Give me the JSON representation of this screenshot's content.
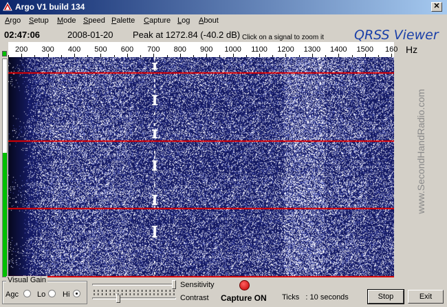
{
  "window": {
    "title": "Argo V1 build 134",
    "close_label": "✕"
  },
  "menu": [
    {
      "label": "Argo",
      "accel": "A",
      "rest": "rgo"
    },
    {
      "label": "Setup",
      "accel": "S",
      "rest": "etup"
    },
    {
      "label": "Mode",
      "accel": "M",
      "rest": "ode"
    },
    {
      "label": "Speed",
      "accel": "S",
      "rest": "peed"
    },
    {
      "label": "Palette",
      "accel": "P",
      "rest": "alette"
    },
    {
      "label": "Capture",
      "accel": "C",
      "rest": "apture"
    },
    {
      "label": "Log",
      "accel": "L",
      "rest": "og"
    },
    {
      "label": "About",
      "accel": "A",
      "rest": "bout"
    }
  ],
  "status": {
    "time": "02:47:06",
    "date": "2008-01-20",
    "peak": "Peak at 1272.84 (-40.2 dB)",
    "hint": "Click on a signal to zoom it"
  },
  "app_title": "QRSS Viewer",
  "scale": {
    "unit": "Hz",
    "labels": [
      "200",
      "300",
      "400",
      "500",
      "600",
      "700",
      "800",
      "900",
      "1000",
      "1100",
      "1200",
      "1300",
      "1400",
      "1500",
      "160"
    ],
    "min_hz": 150,
    "max_hz": 1610
  },
  "brand": "www.SecondHandRadio.com",
  "meter": {
    "level": 0.57
  },
  "gain": {
    "title": "Visual Gain",
    "options": [
      {
        "label": "Agc",
        "checked": false
      },
      {
        "label": "Lo",
        "checked": false
      },
      {
        "label": "Hi",
        "checked": true
      }
    ]
  },
  "sliders": {
    "sensitivity": {
      "label": "Sensitivity",
      "value": 1.0
    },
    "contrast": {
      "label": "Contrast",
      "value": 0.3
    }
  },
  "capture": {
    "label": "Capture ON"
  },
  "ticks": {
    "label": "Ticks   : 10 seconds"
  },
  "buttons": {
    "stop": "Stop",
    "exit": "Exit"
  },
  "colors": {
    "waterfall_bg": "#141c5a",
    "marker_line": "#e00000",
    "meter": "#00c000"
  }
}
